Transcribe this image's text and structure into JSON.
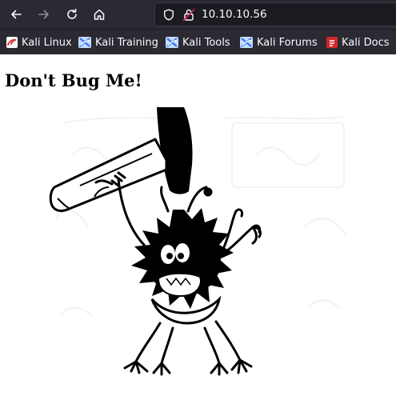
{
  "browser": {
    "address": "10.10.10.56",
    "nav_icons": [
      "back-arrow-icon",
      "forward-arrow-icon",
      "reload-icon",
      "home-icon"
    ],
    "security_icons": [
      "shield-icon",
      "insecure-lock-icon"
    ]
  },
  "bookmarks": [
    {
      "label": "Kali Linux",
      "icon": "kali-linux-icon",
      "color": "#e03a3a"
    },
    {
      "label": "Kali Training",
      "icon": "kali-training-icon",
      "color": "#367bf0"
    },
    {
      "label": "Kali Tools",
      "icon": "kali-tools-icon",
      "color": "#367bf0"
    },
    {
      "label": "Kali Forums",
      "icon": "kali-forums-icon",
      "color": "#367bf0"
    },
    {
      "label": "Kali Docs",
      "icon": "kali-docs-icon",
      "color": "#d12a2a"
    }
  ],
  "page": {
    "heading": "Don't Bug Me!",
    "image": "bug-with-hammer-illustration"
  },
  "colors": {
    "chrome_bg": "#2b2a33",
    "urlbar_bg": "#1c1b22",
    "text": "#fbfbfe",
    "insecure": "#e22850"
  }
}
